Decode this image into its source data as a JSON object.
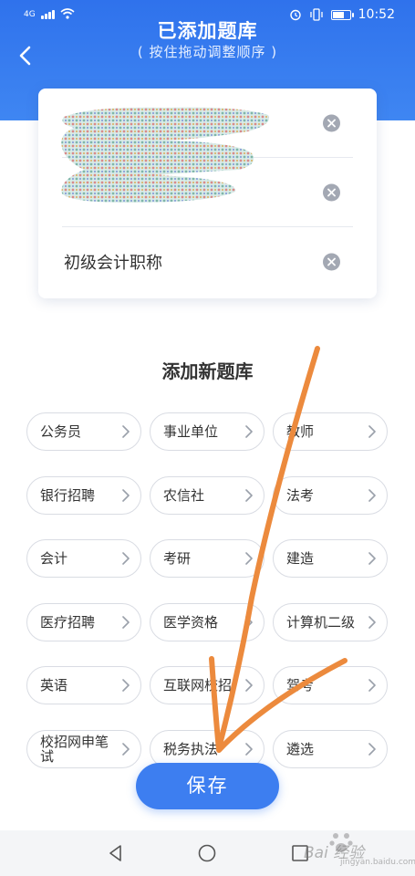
{
  "status_bar": {
    "signal_label": "4G",
    "time": "10:52"
  },
  "header": {
    "title": "已添加题库",
    "subtitle": "( 按住拖动调整顺序 )"
  },
  "added_banks": [
    {
      "label": ""
    },
    {
      "label": ""
    },
    {
      "label": "初级会计职称"
    }
  ],
  "new_section": {
    "title": "添加新题库",
    "categories": [
      {
        "label": "公务员"
      },
      {
        "label": "事业单位"
      },
      {
        "label": "教师"
      },
      {
        "label": "银行招聘"
      },
      {
        "label": "农信社"
      },
      {
        "label": "法考"
      },
      {
        "label": "会计"
      },
      {
        "label": "考研"
      },
      {
        "label": "建造"
      },
      {
        "label": "医疗招聘"
      },
      {
        "label": "医学资格"
      },
      {
        "label": "计算机二级"
      },
      {
        "label": "英语"
      },
      {
        "label": "互联网校招"
      },
      {
        "label": "驾考"
      },
      {
        "label": "校招网申笔试"
      },
      {
        "label": "税务执法"
      },
      {
        "label": "遴选"
      }
    ]
  },
  "save_button": {
    "label": "保存"
  },
  "watermark": {
    "text": "Bai 经验",
    "subtext": "jingyan.baidu.com"
  },
  "colors": {
    "accent": "#3d7ef0",
    "header_top": "#2f72ec",
    "annotation_stroke": "#ec8a3d"
  },
  "icons": {
    "back": "chevron-left-icon",
    "remove": "close-circle-icon",
    "chip_arrow": "chevron-right-icon"
  }
}
